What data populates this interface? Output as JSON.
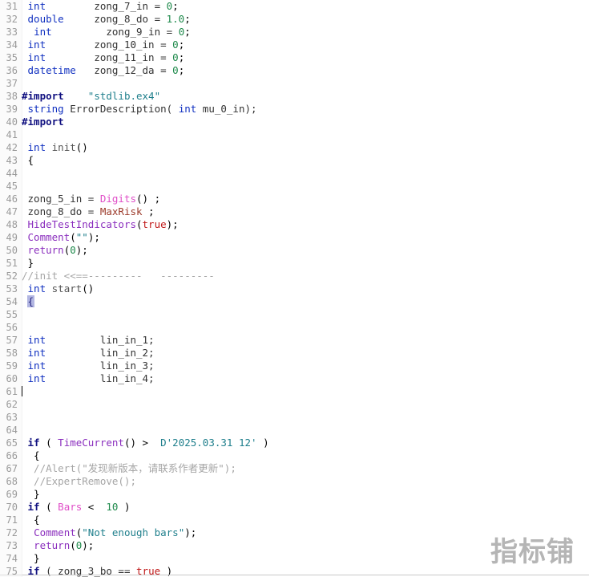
{
  "editor": {
    "name": "mql4-code-editor",
    "first_visible_line": 31,
    "last_visible_line": 75,
    "cursor_line": 61,
    "bracket_match_line": 54,
    "background": "#ffffff",
    "gutter_background": "#fbfbfb",
    "line_number_color": "#9a9a9a"
  },
  "watermark": {
    "text": "指标铺",
    "color": "#b5b5b5"
  },
  "colors": {
    "keyword": "#1030c0",
    "preprocessor": "#101080",
    "number": "#1f8a4c",
    "string": "#1f7f8c",
    "comment": "#a6a6a6",
    "function": "#8b2fbe",
    "constant": "#e04fc8",
    "variable": "#9c3a2a",
    "boolean": "#c01818",
    "bracket_highlight": "#b2b6e2"
  },
  "lines": [
    {
      "n": "31",
      "tokens": [
        {
          "t": " ",
          "c": "t-op"
        },
        {
          "t": "int",
          "c": "t-kw"
        },
        {
          "t": "        zong_7_in = ",
          "c": "t-plain"
        },
        {
          "t": "0",
          "c": "t-num"
        },
        {
          "t": ";",
          "c": "t-op"
        }
      ]
    },
    {
      "n": "32",
      "tokens": [
        {
          "t": " ",
          "c": "t-op"
        },
        {
          "t": "double",
          "c": "t-kw"
        },
        {
          "t": "     zong_8_do = ",
          "c": "t-plain"
        },
        {
          "t": "1.0",
          "c": "t-num"
        },
        {
          "t": ";",
          "c": "t-op"
        }
      ]
    },
    {
      "n": "33",
      "tokens": [
        {
          "t": "  ",
          "c": "t-op"
        },
        {
          "t": "int",
          "c": "t-kw"
        },
        {
          "t": "         zong_9_in = ",
          "c": "t-plain"
        },
        {
          "t": "0",
          "c": "t-num"
        },
        {
          "t": ";",
          "c": "t-op"
        }
      ]
    },
    {
      "n": "34",
      "tokens": [
        {
          "t": " ",
          "c": "t-op"
        },
        {
          "t": "int",
          "c": "t-kw"
        },
        {
          "t": "        zong_10_in = ",
          "c": "t-plain"
        },
        {
          "t": "0",
          "c": "t-num"
        },
        {
          "t": ";",
          "c": "t-op"
        }
      ]
    },
    {
      "n": "35",
      "tokens": [
        {
          "t": " ",
          "c": "t-op"
        },
        {
          "t": "int",
          "c": "t-kw"
        },
        {
          "t": "        zong_11_in = ",
          "c": "t-plain"
        },
        {
          "t": "0",
          "c": "t-num"
        },
        {
          "t": ";",
          "c": "t-op"
        }
      ]
    },
    {
      "n": "36",
      "tokens": [
        {
          "t": " ",
          "c": "t-op"
        },
        {
          "t": "datetime",
          "c": "t-kw"
        },
        {
          "t": "   zong_12_da = ",
          "c": "t-plain"
        },
        {
          "t": "0",
          "c": "t-num"
        },
        {
          "t": ";",
          "c": "t-op"
        }
      ]
    },
    {
      "n": "37",
      "tokens": []
    },
    {
      "n": "38",
      "tokens": [
        {
          "t": "#import",
          "c": "t-pre"
        },
        {
          "t": "    ",
          "c": "t-op"
        },
        {
          "t": "\"stdlib.ex4\"",
          "c": "t-str"
        }
      ]
    },
    {
      "n": "39",
      "tokens": [
        {
          "t": " ",
          "c": "t-op"
        },
        {
          "t": "string",
          "c": "t-kw"
        },
        {
          "t": " ErrorDescription( ",
          "c": "t-plain"
        },
        {
          "t": "int",
          "c": "t-kw"
        },
        {
          "t": " mu_0_in);",
          "c": "t-plain"
        }
      ]
    },
    {
      "n": "40",
      "tokens": [
        {
          "t": "#import",
          "c": "t-pre"
        }
      ]
    },
    {
      "n": "41",
      "tokens": []
    },
    {
      "n": "42",
      "tokens": [
        {
          "t": " ",
          "c": "t-op"
        },
        {
          "t": "int",
          "c": "t-kw"
        },
        {
          "t": " ",
          "c": "t-op"
        },
        {
          "t": "init",
          "c": "t-ident"
        },
        {
          "t": "()",
          "c": "t-op"
        }
      ]
    },
    {
      "n": "43",
      "tokens": [
        {
          "t": " {",
          "c": "t-op"
        }
      ]
    },
    {
      "n": "44",
      "tokens": []
    },
    {
      "n": "45",
      "tokens": []
    },
    {
      "n": "46",
      "tokens": [
        {
          "t": " zong_5_in = ",
          "c": "t-plain"
        },
        {
          "t": "Digits",
          "c": "t-const"
        },
        {
          "t": "() ;",
          "c": "t-op"
        }
      ]
    },
    {
      "n": "47",
      "tokens": [
        {
          "t": " zong_8_do = ",
          "c": "t-plain"
        },
        {
          "t": "MaxRisk",
          "c": "t-var"
        },
        {
          "t": " ;",
          "c": "t-op"
        }
      ]
    },
    {
      "n": "48",
      "tokens": [
        {
          "t": " ",
          "c": "t-op"
        },
        {
          "t": "HideTestIndicators",
          "c": "t-fn"
        },
        {
          "t": "(",
          "c": "t-op"
        },
        {
          "t": "true",
          "c": "t-bool"
        },
        {
          "t": ");",
          "c": "t-op"
        }
      ]
    },
    {
      "n": "49",
      "tokens": [
        {
          "t": " ",
          "c": "t-op"
        },
        {
          "t": "Comment",
          "c": "t-fn"
        },
        {
          "t": "(",
          "c": "t-op"
        },
        {
          "t": "\"\"",
          "c": "t-str"
        },
        {
          "t": ");",
          "c": "t-op"
        }
      ]
    },
    {
      "n": "50",
      "tokens": [
        {
          "t": " ",
          "c": "t-op"
        },
        {
          "t": "return",
          "c": "t-fn"
        },
        {
          "t": "(",
          "c": "t-op"
        },
        {
          "t": "0",
          "c": "t-num"
        },
        {
          "t": ");",
          "c": "t-op"
        }
      ]
    },
    {
      "n": "51",
      "tokens": [
        {
          "t": " }",
          "c": "t-op"
        }
      ]
    },
    {
      "n": "52",
      "tokens": [
        {
          "t": "//init <<==---------   ---------",
          "c": "t-com"
        }
      ]
    },
    {
      "n": "53",
      "tokens": [
        {
          "t": " ",
          "c": "t-op"
        },
        {
          "t": "int",
          "c": "t-kw"
        },
        {
          "t": " ",
          "c": "t-op"
        },
        {
          "t": "start",
          "c": "t-ident"
        },
        {
          "t": "()",
          "c": "t-op"
        }
      ]
    },
    {
      "n": "54",
      "tokens": [
        {
          "t": " ",
          "c": "t-op"
        },
        {
          "t": "{",
          "c": "bracket-hl"
        }
      ]
    },
    {
      "n": "55",
      "tokens": []
    },
    {
      "n": "56",
      "tokens": []
    },
    {
      "n": "57",
      "tokens": [
        {
          "t": " ",
          "c": "t-op"
        },
        {
          "t": "int",
          "c": "t-kw"
        },
        {
          "t": "         lin_in_1;",
          "c": "t-plain"
        }
      ]
    },
    {
      "n": "58",
      "tokens": [
        {
          "t": " ",
          "c": "t-op"
        },
        {
          "t": "int",
          "c": "t-kw"
        },
        {
          "t": "         lin_in_2;",
          "c": "t-plain"
        }
      ]
    },
    {
      "n": "59",
      "tokens": [
        {
          "t": " ",
          "c": "t-op"
        },
        {
          "t": "int",
          "c": "t-kw"
        },
        {
          "t": "         lin_in_3;",
          "c": "t-plain"
        }
      ]
    },
    {
      "n": "60",
      "tokens": [
        {
          "t": " ",
          "c": "t-op"
        },
        {
          "t": "int",
          "c": "t-kw"
        },
        {
          "t": "         lin_in_4;",
          "c": "t-plain"
        }
      ]
    },
    {
      "n": "61",
      "tokens": [],
      "cursor": true
    },
    {
      "n": "62",
      "tokens": []
    },
    {
      "n": "63",
      "tokens": []
    },
    {
      "n": "64",
      "tokens": []
    },
    {
      "n": "65",
      "tokens": [
        {
          "t": " ",
          "c": "t-op"
        },
        {
          "t": "if",
          "c": "t-if"
        },
        {
          "t": " ( ",
          "c": "t-op"
        },
        {
          "t": "TimeCurrent",
          "c": "t-fn"
        },
        {
          "t": "() >  ",
          "c": "t-op"
        },
        {
          "t": "D'2025.03.31 12'",
          "c": "t-str"
        },
        {
          "t": " )",
          "c": "t-op"
        }
      ]
    },
    {
      "n": "66",
      "tokens": [
        {
          "t": "  {",
          "c": "t-op"
        }
      ]
    },
    {
      "n": "67",
      "tokens": [
        {
          "t": "  //Alert(\"发现新版本，请联系作者更新\");",
          "c": "t-com"
        }
      ]
    },
    {
      "n": "68",
      "tokens": [
        {
          "t": "  //ExpertRemove();",
          "c": "t-com"
        }
      ]
    },
    {
      "n": "69",
      "tokens": [
        {
          "t": "  }",
          "c": "t-op"
        }
      ]
    },
    {
      "n": "70",
      "tokens": [
        {
          "t": " ",
          "c": "t-op"
        },
        {
          "t": "if",
          "c": "t-if"
        },
        {
          "t": " ( ",
          "c": "t-op"
        },
        {
          "t": "Bars",
          "c": "t-const"
        },
        {
          "t": " <  ",
          "c": "t-op"
        },
        {
          "t": "10",
          "c": "t-num"
        },
        {
          "t": " )",
          "c": "t-op"
        }
      ]
    },
    {
      "n": "71",
      "tokens": [
        {
          "t": "  {",
          "c": "t-op"
        }
      ]
    },
    {
      "n": "72",
      "tokens": [
        {
          "t": "  ",
          "c": "t-op"
        },
        {
          "t": "Comment",
          "c": "t-fn"
        },
        {
          "t": "(",
          "c": "t-op"
        },
        {
          "t": "\"Not enough bars\"",
          "c": "t-str"
        },
        {
          "t": ");",
          "c": "t-op"
        }
      ]
    },
    {
      "n": "73",
      "tokens": [
        {
          "t": "  ",
          "c": "t-op"
        },
        {
          "t": "return",
          "c": "t-fn"
        },
        {
          "t": "(",
          "c": "t-op"
        },
        {
          "t": "0",
          "c": "t-num"
        },
        {
          "t": ");",
          "c": "t-op"
        }
      ]
    },
    {
      "n": "74",
      "tokens": [
        {
          "t": "  }",
          "c": "t-op"
        }
      ]
    },
    {
      "n": "75",
      "tokens": [
        {
          "t": " ",
          "c": "t-op"
        },
        {
          "t": "if",
          "c": "t-if"
        },
        {
          "t": " ( zong_3_bo == ",
          "c": "t-plain"
        },
        {
          "t": "true",
          "c": "t-bool"
        },
        {
          "t": " )",
          "c": "t-op"
        }
      ]
    }
  ]
}
